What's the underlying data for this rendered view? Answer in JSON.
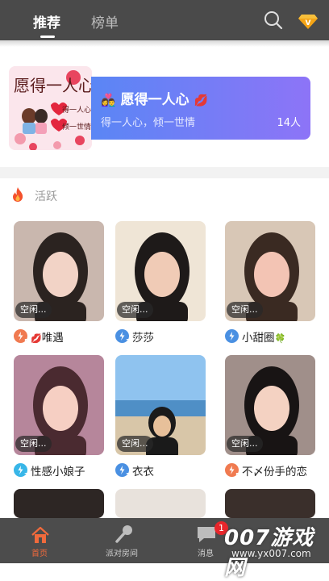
{
  "header": {
    "tabs": [
      {
        "label": "推荐",
        "active": true
      },
      {
        "label": "榜单",
        "active": false
      }
    ]
  },
  "room": {
    "title": "愿得一人心",
    "desc": "得一人心，倾一世情",
    "count": "14人",
    "thumb_text": [
      "愿得一人心",
      "得一人心",
      "倾一世情"
    ]
  },
  "section": {
    "title": "活跃"
  },
  "users": [
    {
      "name": "唯遇",
      "status": "空闲...",
      "level": "5",
      "level_color": "#f07a50",
      "prefix_emoji": "💋",
      "suffix_emoji": ""
    },
    {
      "name": "莎莎",
      "status": "空闲...",
      "level": "3",
      "level_color": "#4a90e2",
      "prefix_emoji": "",
      "suffix_emoji": ""
    },
    {
      "name": "小甜圈",
      "status": "空闲...",
      "level": "",
      "level_color": "#4a90e2",
      "prefix_emoji": "",
      "suffix_emoji": "🍀"
    },
    {
      "name": "性感小娘子",
      "status": "空闲...",
      "level": "2",
      "level_color": "#38b6e8",
      "prefix_emoji": "",
      "suffix_emoji": ""
    },
    {
      "name": "衣衣",
      "status": "空闲...",
      "level": "3",
      "level_color": "#4a90e2",
      "prefix_emoji": "",
      "suffix_emoji": ""
    },
    {
      "name": "不〆份手的恋",
      "status": "空闲...",
      "level": "5",
      "level_color": "#f07a50",
      "prefix_emoji": "",
      "suffix_emoji": ""
    }
  ],
  "bottom_nav": [
    {
      "label": "首页",
      "active": true
    },
    {
      "label": "派对房间",
      "active": false
    },
    {
      "label": "消息",
      "badge": "1",
      "active": false
    }
  ],
  "watermark": {
    "brand": "007游戏网",
    "url": "www.yx007.com"
  },
  "colors": {
    "accent": "#f06a3c",
    "header_bg": "#4a4a4a",
    "card_gradient_start": "#5a86f5",
    "card_gradient_end": "#8d74f7"
  }
}
